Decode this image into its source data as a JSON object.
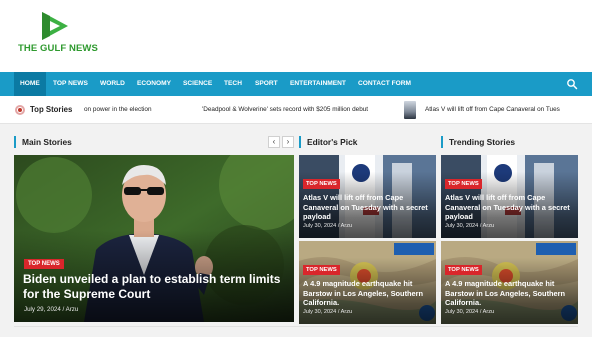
{
  "site": {
    "name": "THE GULF NEWS",
    "logo_color": "#2f9a2f",
    "accent_color": "#1a9bc7",
    "badge_color": "#d9262b"
  },
  "nav": {
    "items": [
      "HOME",
      "TOP NEWS",
      "WORLD",
      "ECONOMY",
      "SCIENCE",
      "TECH",
      "SPORT",
      "ENTERTAINMENT",
      "CONTACT FORM"
    ],
    "active": "HOME",
    "search_icon": "search-icon"
  },
  "ticker": {
    "label": "Top Stories",
    "items": [
      "on power in the election",
      "'Deadpool & Wolverine' sets record with $205 million debut",
      "Atlas V will lift off from Cape Canaveral on Tues"
    ]
  },
  "sections": {
    "main": "Main Stories",
    "editors": "Editor's Pick",
    "trending": "Trending Stories"
  },
  "arrows": {
    "prev": "‹",
    "next": "›"
  },
  "main_story": {
    "badge": "TOP NEWS",
    "title": "Biden unveiled a plan to establish term limits for the Supreme Court",
    "meta": "July 29, 2024 / Arzu"
  },
  "editors_pick": [
    {
      "badge": "TOP NEWS",
      "title": "Atlas V will lift off from Cape Canaveral on Tuesday with a secret payload",
      "meta": "July 30, 2024 / Arzu"
    },
    {
      "badge": "TOP NEWS",
      "title": "A 4.9 magnitude earthquake hit Barstow in Los Angeles, Southern California.",
      "meta": "July 30, 2024 / Arzu"
    }
  ],
  "trending": [
    {
      "badge": "TOP NEWS",
      "title": "Atlas V will lift off from Cape Canaveral on Tuesday with a secret payload",
      "meta": "July 30, 2024 / Arzu"
    },
    {
      "badge": "TOP NEWS",
      "title": "A 4.9 magnitude earthquake hit Barstow in Los Angeles, Southern California.",
      "meta": "July 30, 2024 / Arzu"
    }
  ]
}
